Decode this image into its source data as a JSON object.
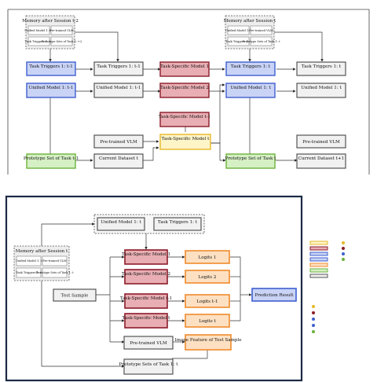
{
  "top": {
    "mem_left": {
      "title": "Memory after Session t-2",
      "box1": "Unified Model 1: t-2",
      "box2": "Pre-trained VLM",
      "box3": "Task Triggers 1: t-2",
      "box4": "Prototype Sets of Task 1: t-2"
    },
    "mem_right": {
      "title": "Memory after Session t",
      "box1": "Unified Model 1: t",
      "box2": "Pre-trained VLM",
      "box3": "Task Triggers 1: t",
      "box4": "Prototype Sets of Task 1: t"
    },
    "left_col": {
      "triggers": "Task Triggers 1: t-1",
      "unified": "Unified Model 1: t-1",
      "proto": "Prototype Set of Task t-1"
    },
    "col2": {
      "triggers": "Task Triggers 1: t-1",
      "unified": "Unified Model 1: t-1",
      "vlm": "Pre-trained VLM",
      "dataset": "Current Dataset t"
    },
    "col3": {
      "m1": "Task-Specific Model 1",
      "m2": "Task-Specific Model 2",
      "mt1": "Task-Specific Model t-1",
      "mt": "Task-Specific Model t"
    },
    "col4": {
      "triggers": "Task Triggers 1: t",
      "unified": "Unified Model 1: t",
      "proto": "Prototype Set of Task t"
    },
    "col5": {
      "triggers": "Task Triggers 1: t",
      "unified": "Unified Model 1: t",
      "vlm": "Pre-trained VLM",
      "dataset": "Current Dataset t+1"
    }
  },
  "bottom": {
    "unified": "Unified Model 1: t",
    "triggers": "Task Triggers 1: t",
    "mem": {
      "title": "Memory after Session t",
      "box1": "Unified Model 1: t",
      "box2": "Pre-trained VLM",
      "box3": "Task Triggers 1: t",
      "box4": "Prototype Sets of Task 1: t"
    },
    "test_sample": "Test Sample",
    "models": {
      "m1": "Task-Specific Model 1",
      "m2": "Task-Specific Model 2",
      "mt1": "Task-Specific Model t-1",
      "mt": "Task-Specific Model t"
    },
    "logits": {
      "l1": "Logits 1",
      "l2": "Logits 2",
      "lt1": "Logits t-1",
      "lt": "Logits t"
    },
    "prediction": "Prediction Result",
    "vlm": "Pre-trained VLM",
    "image_feature": "Image Feature of Test Sample",
    "proto": "Prototype Sets of Task 1: t"
  },
  "colors": {
    "blue_fill": "#c9d3f5",
    "blue_border": "#3f5fd0",
    "red_fill": "#e8aeb3",
    "red_border": "#8b1c2a",
    "yellow_fill": "#fdf4c8",
    "yellow_border": "#e7b928",
    "green_fill": "#d5f0c4",
    "green_border": "#6cb23b",
    "orange_fill": "#fde0c2",
    "orange_border": "#f08a2c",
    "gray_fill": "#f1f1f1",
    "gray_border": "#555555",
    "navy_frame": "#1c2a45"
  }
}
